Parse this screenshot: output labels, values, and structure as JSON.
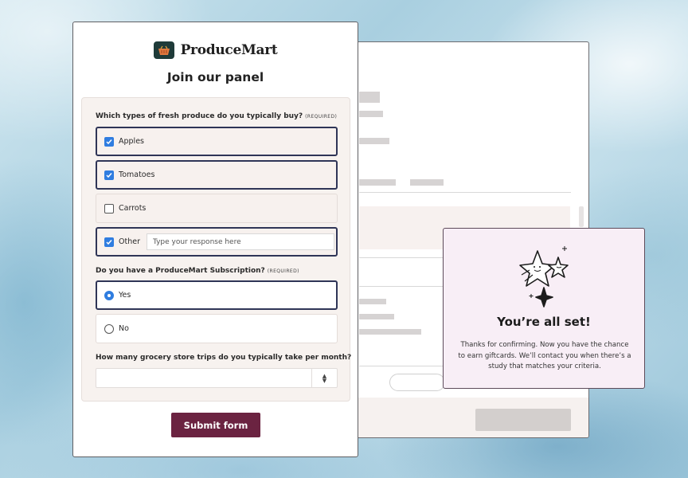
{
  "brand": {
    "name": "ProduceMart",
    "logo_icon": "basket-icon"
  },
  "form": {
    "title": "Join our panel",
    "q1": {
      "label": "Which types of fresh produce do you typically buy?",
      "required": "(REQUIRED)",
      "options": [
        {
          "label": "Apples",
          "checked": true
        },
        {
          "label": "Tomatoes",
          "checked": true
        },
        {
          "label": "Carrots",
          "checked": false
        },
        {
          "label": "Other",
          "checked": true
        }
      ],
      "other_placeholder": "Type your response here"
    },
    "q2": {
      "label": "Do you have a ProduceMart Subscription?",
      "required": "(REQUIRED)",
      "options": [
        {
          "label": "Yes",
          "selected": true
        },
        {
          "label": "No",
          "selected": false
        }
      ]
    },
    "q3": {
      "label": "How many grocery store trips do you typically take per month?",
      "value": ""
    },
    "submit_label": "Submit form"
  },
  "confirmation": {
    "icon": "stars-icon",
    "title": "You’re all set!",
    "body": "Thanks for confirming. Now you have the chance to earn giftcards. We’ll contact you when there’s a study that matches your criteria."
  },
  "colors": {
    "brand_dark": "#1f3b39",
    "submit": "#6b2341",
    "selected_border": "#2f3557",
    "check_blue": "#2f7de0",
    "confirm_bg": "#f8eef6"
  }
}
